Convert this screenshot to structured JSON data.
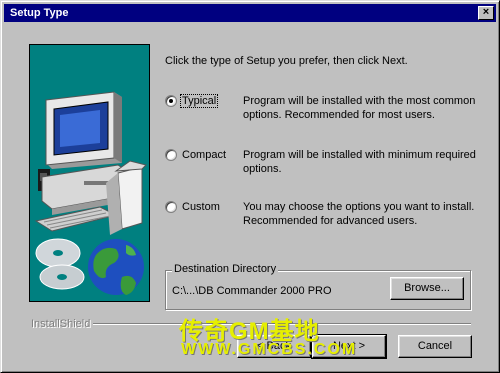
{
  "window": {
    "title": "Setup Type",
    "close_glyph": "×"
  },
  "intro": "Click the type of Setup you prefer, then click Next.",
  "options": [
    {
      "label": "Typical",
      "selected": true,
      "description": "Program will be installed with the most common options. Recommended for most users."
    },
    {
      "label": "Compact",
      "selected": false,
      "description": "Program will be installed with minimum required options."
    },
    {
      "label": "Custom",
      "selected": false,
      "description": "You may choose the options you want to install. Recommended for advanced users."
    }
  ],
  "destination": {
    "group_label": "Destination Directory",
    "path": "C:\\...\\DB Commander 2000 PRO",
    "browse_label": "Browse..."
  },
  "footer": {
    "brand": "InstallShield",
    "back_label": "< Back",
    "next_label": "Next >",
    "cancel_label": "Cancel"
  },
  "watermark": {
    "line1": "传奇GM基地",
    "line2": "WWW.GMCBS.COM",
    "color": "#e6ef00"
  },
  "icons": {
    "illustration": "computer-with-cds-and-globe"
  }
}
